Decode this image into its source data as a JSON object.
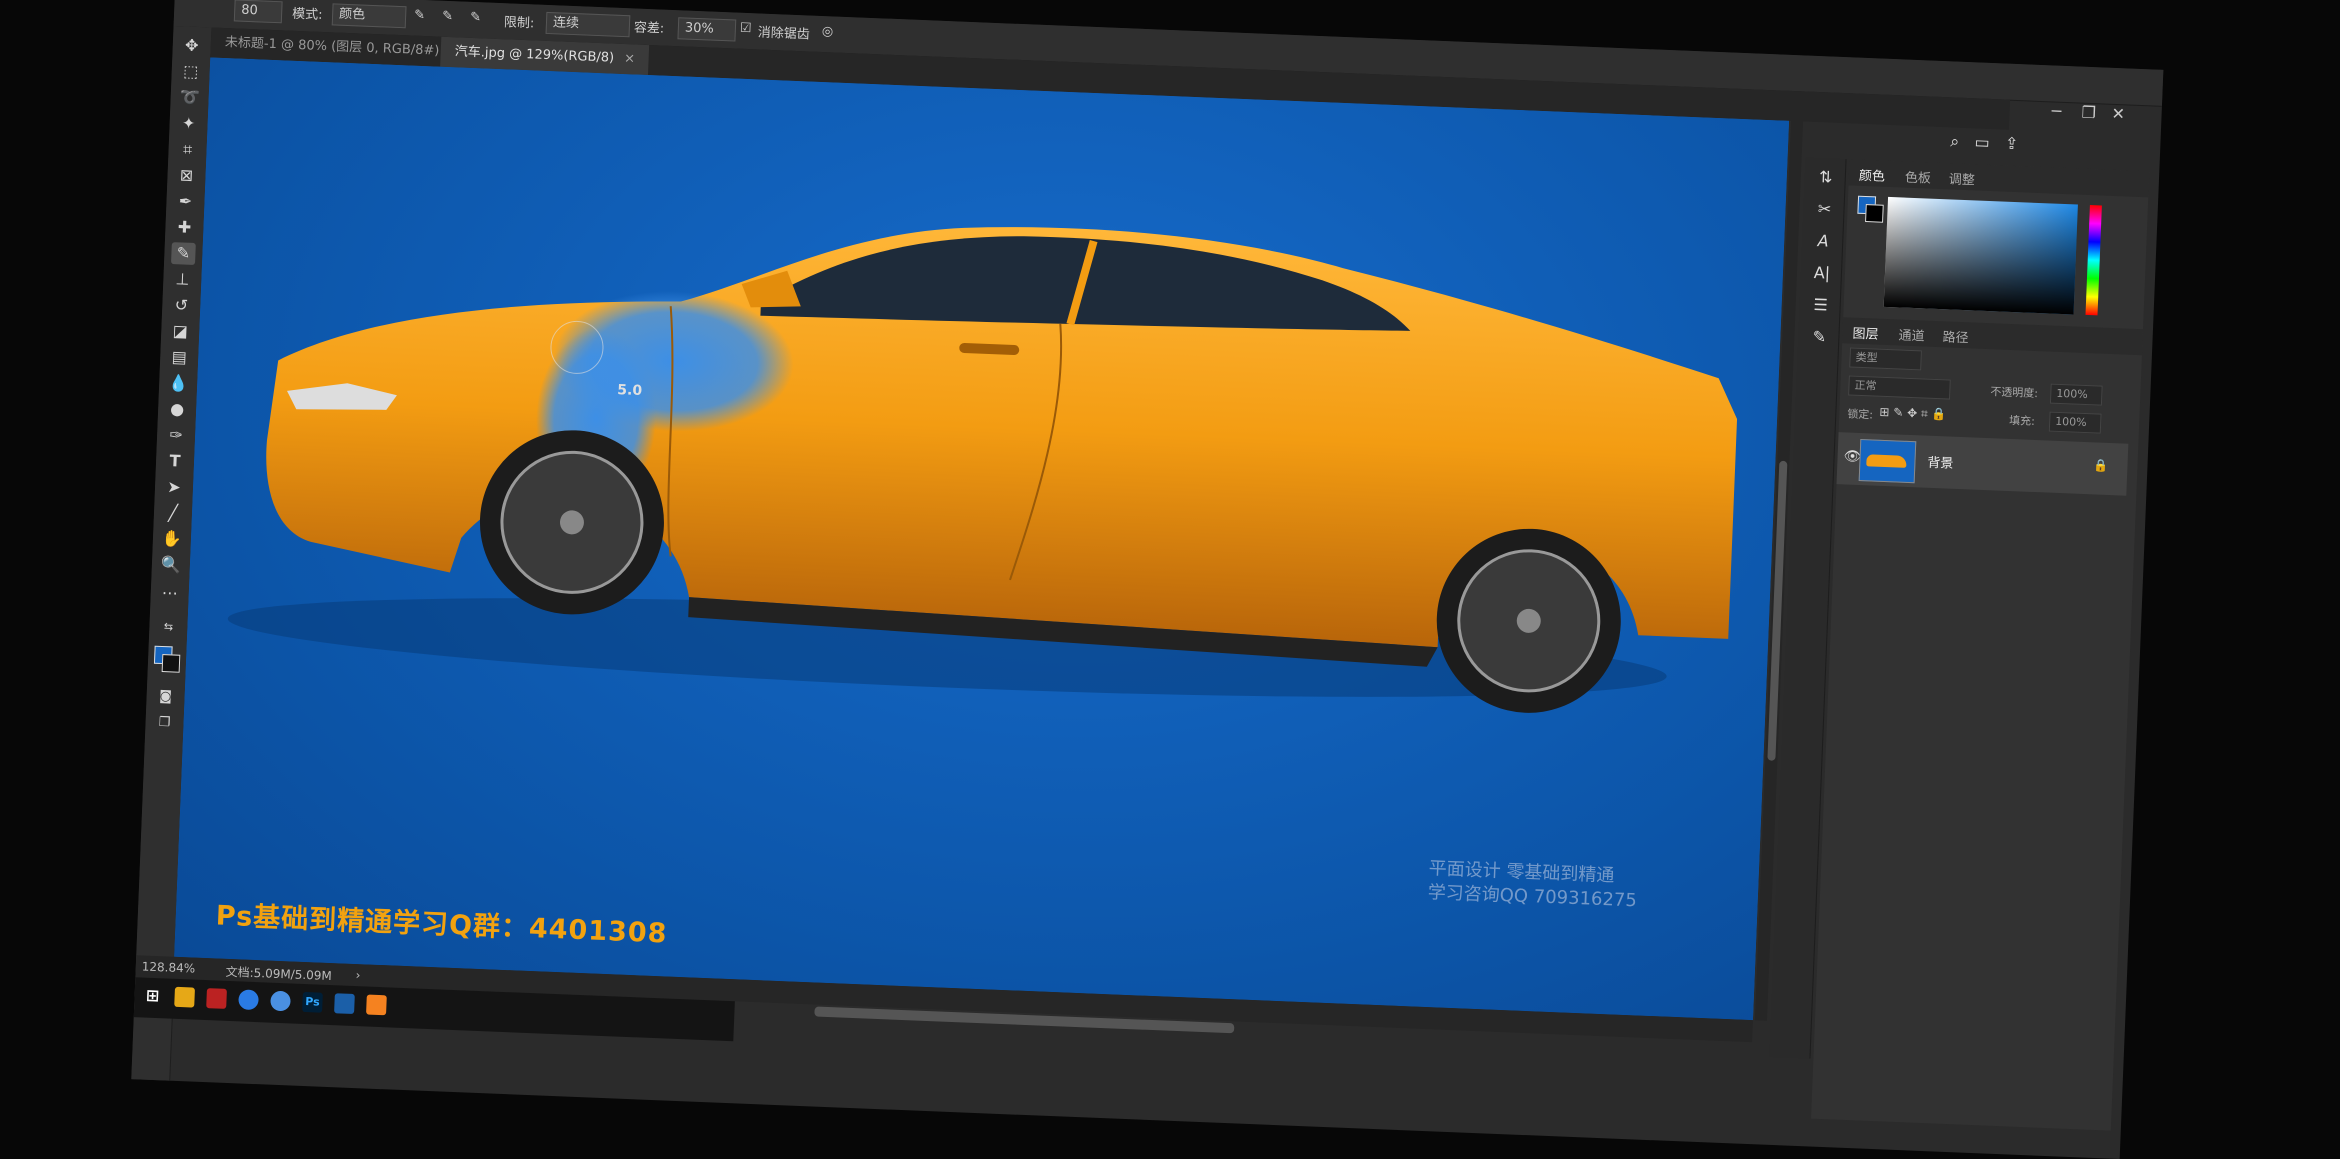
{
  "options_bar": {
    "field_value": "80",
    "mode_label": "模式:",
    "mode_value": "颜色",
    "limits_label": "限制:",
    "limits_value": "连续",
    "tolerance_label": "容差:",
    "tolerance_value": "30%",
    "antialias_label": "消除锯齿"
  },
  "tabs": [
    {
      "label": "未标题-1 @ 80% (图层 0, RGB/8#) *"
    },
    {
      "label": "汽车.jpg @ 129%(RGB/8)"
    }
  ],
  "canvas": {
    "background_color": "#0f5fb6",
    "car_color": "#f39c12",
    "badge_text": "5.0",
    "watermark_main": "Ps基础到精通学习Q群：4401308",
    "watermark_line1": "平面设计  零基础到精通",
    "watermark_line2": "学习咨询QQ 709316275"
  },
  "status": {
    "zoom": "128.84%",
    "doc_size": "文档:5.09M/5.09M"
  },
  "color_panel": {
    "tabs": [
      "颜色",
      "色板",
      "调整"
    ],
    "foreground": "#1565c0",
    "background": "#000000"
  },
  "layers_panel": {
    "tabs": [
      "图层",
      "通道",
      "路径"
    ],
    "filter_placeholder": "类型",
    "blend_mode": "正常",
    "opacity_label": "不透明度:",
    "opacity_value": "100%",
    "lock_label": "锁定:",
    "fill_label": "填充:",
    "fill_value": "100%",
    "layers": [
      {
        "name": "背景"
      }
    ]
  },
  "taskbar": {
    "apps": [
      "windows",
      "file-explorer",
      "app-1",
      "browser",
      "chrome",
      "Ps",
      "app-2",
      "media-player"
    ]
  }
}
